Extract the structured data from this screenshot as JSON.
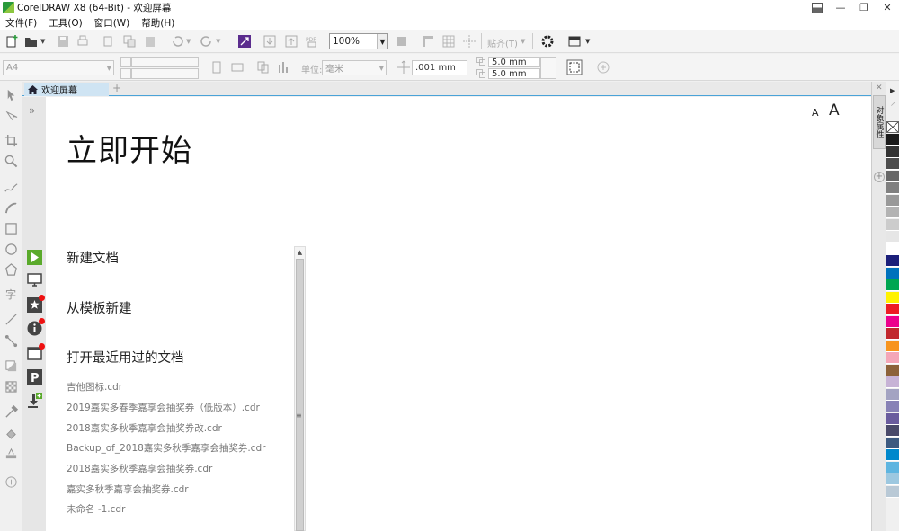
{
  "window": {
    "title": "CorelDRAW X8 (64-Bit) - 欢迎屏幕",
    "minimize": "—",
    "restore": "❐",
    "close": "✕"
  },
  "menu": [
    "文件(F)",
    "工具(O)",
    "窗口(W)",
    "帮助(H)"
  ],
  "toolbar": {
    "zoom": "100%",
    "snap_label": "贴齐(T)"
  },
  "property_bar": {
    "page_size": "A4",
    "units_label": "单位:",
    "units": "毫米",
    "nudge": ".001 mm",
    "dup_x": "5.0 mm",
    "dup_y": "5.0 mm"
  },
  "doc_tabs": [
    {
      "label": "欢迎屏幕",
      "active": true
    }
  ],
  "welcome": {
    "font_small": "A",
    "font_large": "A",
    "title": "立即开始",
    "sections": [
      "新建文档",
      "从模板新建",
      "打开最近用过的文档"
    ],
    "recent_files": [
      "吉他图标.cdr",
      "2019嘉实多春季嘉享会抽奖券（低版本）.cdr",
      "2018嘉实多秋季嘉享会抽奖券改.cdr",
      "Backup_of_2018嘉实多秋季嘉享会抽奖券.cdr",
      "2018嘉实多秋季嘉享会抽奖券.cdr",
      "嘉实多秋季嘉享会抽奖券.cdr",
      "未命名 -1.cdr"
    ]
  },
  "docker": {
    "tab_label": "对象属性"
  },
  "palette_colors": [
    "#1a1a1a",
    "#333333",
    "#4d4d4d",
    "#666666",
    "#808080",
    "#999999",
    "#b3b3b3",
    "#cccccc",
    "#e6e6e6",
    "#ffffff",
    "#1b1f7a",
    "#0072bc",
    "#00a651",
    "#fff200",
    "#ed1c24",
    "#ec008c",
    "#c1272d",
    "#f7941d",
    "#f4a6b7",
    "#8c6239",
    "#c7b3d6",
    "#a3a3c2",
    "#8882b6",
    "#6a5c9e",
    "#4a4a6a",
    "#3d5a80",
    "#0088cc",
    "#5eb5e0",
    "#9dc8e0",
    "#b9c9d6"
  ]
}
